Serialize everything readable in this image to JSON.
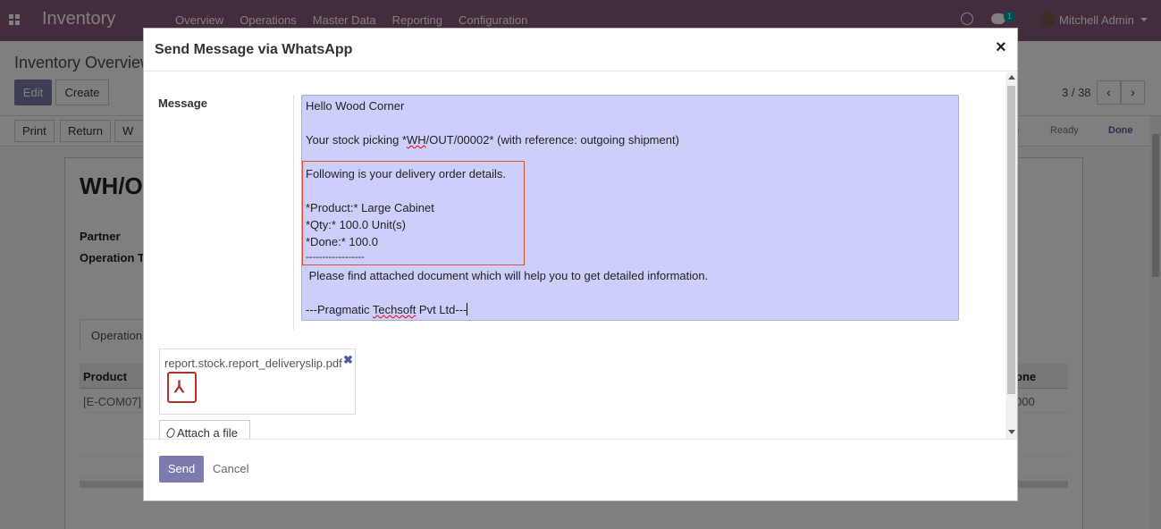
{
  "navbar": {
    "app_title": "Inventory",
    "menu": [
      "Overview",
      "Operations",
      "Master Data",
      "Reporting",
      "Configuration"
    ],
    "chat_badge": "1",
    "user_name": "Mitchell Admin"
  },
  "page": {
    "breadcrumb": "Inventory Overview",
    "edit_label": "Edit",
    "create_label": "Create",
    "pager": "3 / 38",
    "print_label": "Print",
    "return_label": "Return",
    "whatsapp_label": "W",
    "stages": [
      "g",
      "Ready",
      "Done"
    ],
    "record_title": "WH/O",
    "partner_label": "Partner",
    "operation_type_label": "Operation T",
    "tab_operations": "Operations",
    "col_product": "Product",
    "col_done": "one",
    "row_product": "[E-COM07]",
    "row_done": "000"
  },
  "modal": {
    "title": "Send Message via WhatsApp",
    "close_symbol": "×",
    "message_label": "Message",
    "message": {
      "line1": "Hello Wood Corner",
      "line2_pre": "Your stock picking *",
      "line2_spell": "WH",
      "line2_post": "/OUT/00002* (with reference: outgoing shipment)",
      "line3": "Following is your delivery order details.",
      "line4": "*Product:* Large Cabinet",
      "line5": "*Qty:* 100.0 Unit(s)",
      "line6": "*Done:* 100.0",
      "line7": "------------------",
      "line8": " Please find attached document which will help you to get detailed information.",
      "line9_pre": "---Pragmatic ",
      "line9_spell": "Techsoft",
      "line9_post": " Pvt Ltd---"
    },
    "attachment_name": "report.stock.report_deliveryslip.pdf",
    "attachment_remove": "✖",
    "attach_button": "Attach a file",
    "send_label": "Send",
    "cancel_label": "Cancel"
  },
  "colors": {
    "navbar": "#875a7b",
    "primary": "#7c7bad",
    "message_bg": "#cccffa",
    "selection_border": "#e04a3f"
  }
}
